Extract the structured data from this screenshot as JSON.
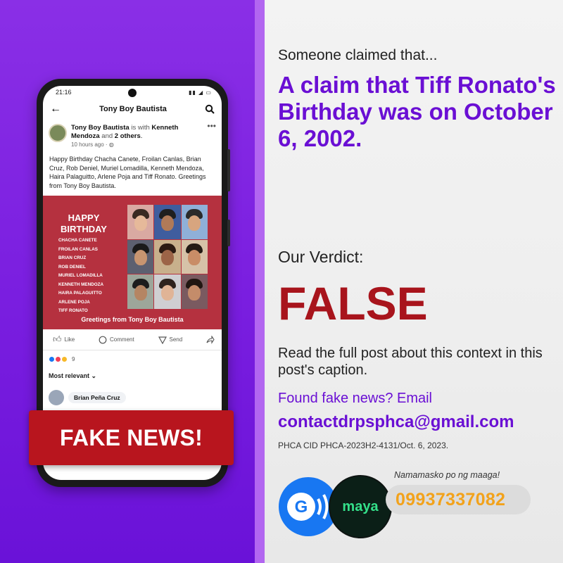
{
  "phone": {
    "status_time": "21:16",
    "nav_title": "Tony Boy Bautista",
    "post": {
      "author": "Tony Boy Bautista",
      "with_text": "is with",
      "tagged": "Kenneth Mendoza",
      "and_text": "and",
      "others": "2 others",
      "time": "10 hours ago",
      "body": "Happy Birthday Chacha Canete, Froilan Canlas, Brian Cruz, Rob Deniel, Muriel Lomadilla, Kenneth Mendoza, Haira Palaguitto, Arlene Poja and Tiff Ronato. Greetings from Tony Boy Bautista."
    },
    "card": {
      "title_line1": "HAPPY",
      "title_line2": "BIRTHDAY",
      "names": [
        "CHACHA CANETE",
        "FROILAN CANLAS",
        "BRIAN CRUZ",
        "ROB DENIEL",
        "MURIEL LOMADILLA",
        "KENNETH MENDOZA",
        "HAIRA PALAGUITTO",
        "ARLENE POJA",
        "TIFF RONATO"
      ],
      "greeting": "Greetings from Tony Boy Bautista"
    },
    "actions": {
      "like": "Like",
      "comment": "Comment",
      "send": "Send"
    },
    "reaction_count": "9",
    "sort_label": "Most relevant",
    "commenter": "Brian Peña Cruz"
  },
  "banner": "FAKE NEWS!",
  "claim_intro": "Someone claimed that...",
  "claim": "A claim that Tiff Ronato's Birthday was on October 6, 2002.",
  "verdict_label": "Our Verdict:",
  "verdict": "FALSE",
  "read_full": "Read the full post about this context in this post's caption.",
  "found_fake": "Found fake news? Email",
  "email": "contactdrpsphca@gmail.com",
  "cid": "PHCA CID PHCA-2023H2-4131/Oct. 6, 2023.",
  "donate": {
    "gcash_label": "G",
    "maya_label": "maya",
    "tagline": "Namamasko po ng maaga!",
    "number": "09937337082"
  },
  "colors": {
    "purple": "#6a0fd4",
    "verdict_red": "#a8141c",
    "banner_red": "#b8151e",
    "card_red": "#b5313f",
    "number_orange": "#f2a21b"
  }
}
